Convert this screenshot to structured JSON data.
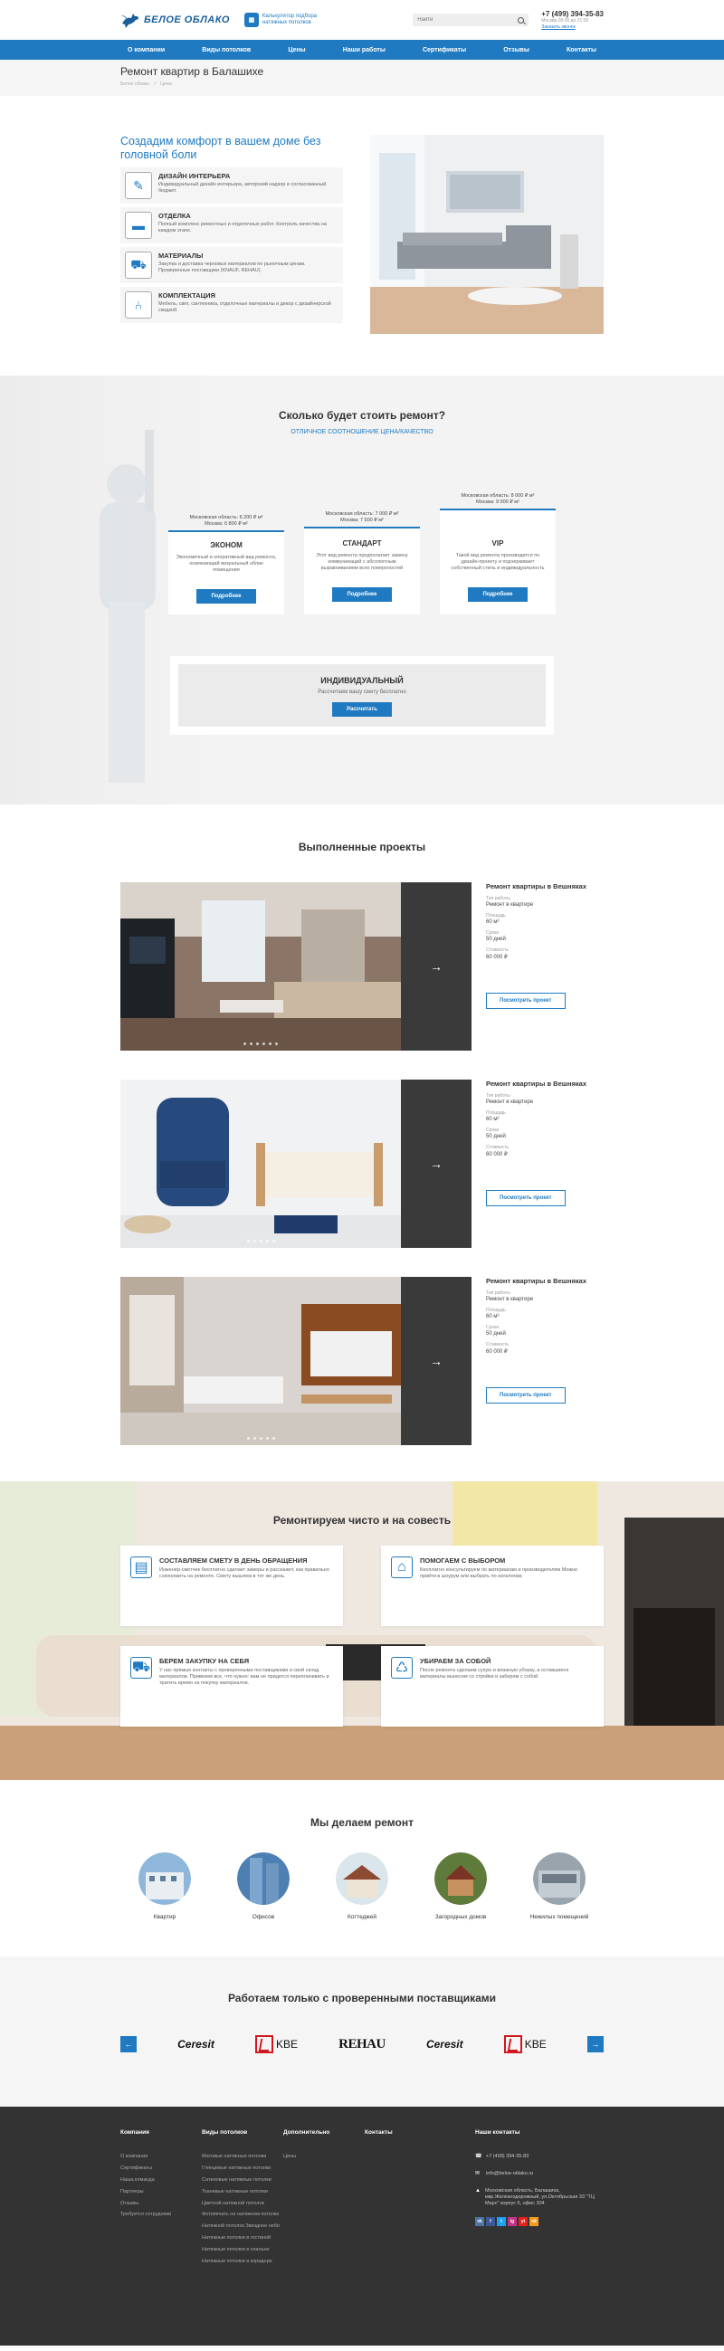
{
  "header": {
    "logo_text": "БЕЛОЕ ОБЛАКО",
    "calc_icon": "calculator-icon",
    "calc_label": "Калькулятор подбора натяжных потолков",
    "search_placeholder": "Найти",
    "phone": "+7 (499) 394-35-83",
    "hours": "Москва 09:00 до 21:00",
    "callback": "Заказать звонок"
  },
  "nav": [
    "О компании",
    "Виды потолков",
    "Цены",
    "Наши работы",
    "Сертификаты",
    "Отзывы",
    "Контакты"
  ],
  "page": {
    "title": "Ремонт квартир в Балашихе",
    "breadcrumb": [
      "Белое облако",
      "/",
      "Цены"
    ]
  },
  "intro": {
    "title": "Создадим комфорт в вашем доме без головной боли",
    "features": [
      {
        "icon": "design-icon",
        "title": "ДИЗАЙН ИНТЕРЬЕРА",
        "text": "Индивидуальный дизайн интерьера, авторский надзор и согласованный бюджет."
      },
      {
        "icon": "roller-icon",
        "title": "ОТДЕЛКА",
        "text": "Полный комплекс ремонтных и отделочных работ. Контроль качества на каждом этапе."
      },
      {
        "icon": "truck-icon",
        "title": "МАТЕРИАЛЫ",
        "text": "Закупка и доставка черновых материалов по рыночным ценам. Проверенные поставщики (KNAUF, REHAU)."
      },
      {
        "icon": "armchair-icon",
        "title": "КОМПЛЕКТАЦИЯ",
        "text": "Мебель, свет, сантехника, отделочные материалы и декор с дизайнерской скидкой."
      }
    ]
  },
  "pricing": {
    "title": "Сколько будет стоить ремонт?",
    "subtitle": "ОТЛИЧНОЕ СООТНОШЕНИЕ ЦЕНА/КАЧЕСТВО",
    "plans": [
      {
        "price1": "Московская область: 6 200 ₽ м²",
        "price2": "Москва: 6 800 ₽ м²",
        "name": "ЭКОНОМ",
        "text": "Экономичный и оперативный вид ремонта, освежающий визуальный облик помещения",
        "button": "Подробнее"
      },
      {
        "price1": "Московская область: 7 000 ₽ м²",
        "price2": "Москва: 7 500 ₽ м²",
        "name": "СТАНДАРТ",
        "text": "Этот вид ремонта предполагает замену коммуникаций с абсолютным выравниванием всех поверхностей",
        "button": "Подробнее"
      },
      {
        "price1": "Московская область: 8 000 ₽ м²",
        "price2": "Москва: 9 000 ₽ м²",
        "name": "VIP",
        "text": "Такой вид ремонта производится по дизайн-проекту и подчеркивает собственный стиль и индивидуальность",
        "button": "Подробнее"
      }
    ],
    "individual": {
      "name": "ИНДИВИДУАЛЬНЫЙ",
      "text": "Рассчитаем вашу смету бесплатно",
      "button": "Рассчитать"
    }
  },
  "projects": {
    "title": "Выполненные проекты",
    "labels": {
      "type": "Тип работы",
      "area": "Площадь",
      "term": "Сроки",
      "cost": "Стоимость"
    },
    "button": "Посмотреть проект",
    "items": [
      {
        "title": "Ремонт квартиры в Вешняках",
        "type": "Ремонт в квартире",
        "area": "60 м²",
        "term": "50 дней",
        "cost": "60 000 ₽"
      },
      {
        "title": "Ремонт квартиры в Вешняках",
        "type": "Ремонт в квартире",
        "area": "60 м²",
        "term": "50 дней",
        "cost": "60 000 ₽"
      },
      {
        "title": "Ремонт квартиры в Вешняках",
        "type": "Ремонт в квартире",
        "area": "60 м²",
        "term": "50 дней",
        "cost": "60 000 ₽"
      }
    ]
  },
  "honest": {
    "title": "Ремонтируем чисто и на совесть",
    "cards": [
      {
        "icon": "estimate-icon",
        "title": "СОСТАВЛЯЕМ СМЕТУ В ДЕНЬ ОБРАЩЕНИЯ",
        "text": "Инженер-сметчик бесплатно сделает замеры и расскажет, как правильно сэкономить на ремонте. Смету вышлем в тот же день."
      },
      {
        "icon": "house-icon",
        "title": "ПОМОГАЕМ С ВЫБОРОМ",
        "text": "Бесплатно консультируем по материалам и производителям Можно прийти в шоурум или выбрать по каталогам."
      },
      {
        "icon": "cart-icon",
        "title": "БЕРЕМ ЗАКУПКУ НА СЕБЯ",
        "text": "У нас прямые контакты с проверенными поставщиками и свой склад материалов. Привезем все, что нужно: вам не придется переплачивать и тратить время на покупку материалов."
      },
      {
        "icon": "cleaning-icon",
        "title": "УБИРАЕМ ЗА СОБОЙ",
        "text": "После ремонта сделаем сухую и влажную уборку, а оставшиеся материалы вынесем со стройки и заберем с собой."
      }
    ]
  },
  "repair": {
    "title": "Мы делаем ремонт",
    "items": [
      "Квартир",
      "Офисов",
      "Коттеджей",
      "Загородных домов",
      "Нежилых помещений"
    ]
  },
  "suppliers": {
    "title": "Работаем только с проверенными поставщиками",
    "logos": [
      "Ceresit",
      "KBE",
      "REHAU",
      "Ceresit",
      "KBE"
    ]
  },
  "footer": {
    "company_title": "Компания",
    "company_links": [
      "О компании",
      "Сертификаты",
      "Наша команда",
      "Партнеры",
      "Отзывы",
      "Требуется сотрудники"
    ],
    "services_title": "Виды потолков",
    "services_links": [
      "Матовые натяжные потолки",
      "Глянцевые натяжные потолки",
      "Сатиновые натяжные потолки",
      "Тканевые натяжные потолки",
      "Цветной натяжной потолок",
      "Фотопечать на натяжном потолке",
      "Натяжной потолок Звездное небо",
      "Натяжные потолки в гостиной",
      "Натяжные потолки в спальне",
      "Натяжные потолки в коридоре"
    ],
    "extra_title": "Дополнительно",
    "extra_links": [
      "Цены"
    ],
    "contacts_title": "Контакты",
    "our_contacts_title": "Наши контакты",
    "phone": "+7 (499) 394-35-83",
    "email": "info@beloe-oblako.ru",
    "address": "Московская область, Балашиха, мкр.Железнодорожный, ул.Октябрьская 33 \"ТЦ Марс\" корпус 6, офис 304",
    "socials": [
      {
        "label": "vk",
        "color": "#4c75a3"
      },
      {
        "label": "f",
        "color": "#3b5998"
      },
      {
        "label": "t",
        "color": "#1da1f2"
      },
      {
        "label": "ig",
        "color": "#c13584"
      },
      {
        "label": "yt",
        "color": "#e62117"
      },
      {
        "label": "ok",
        "color": "#f59a1c"
      }
    ]
  }
}
